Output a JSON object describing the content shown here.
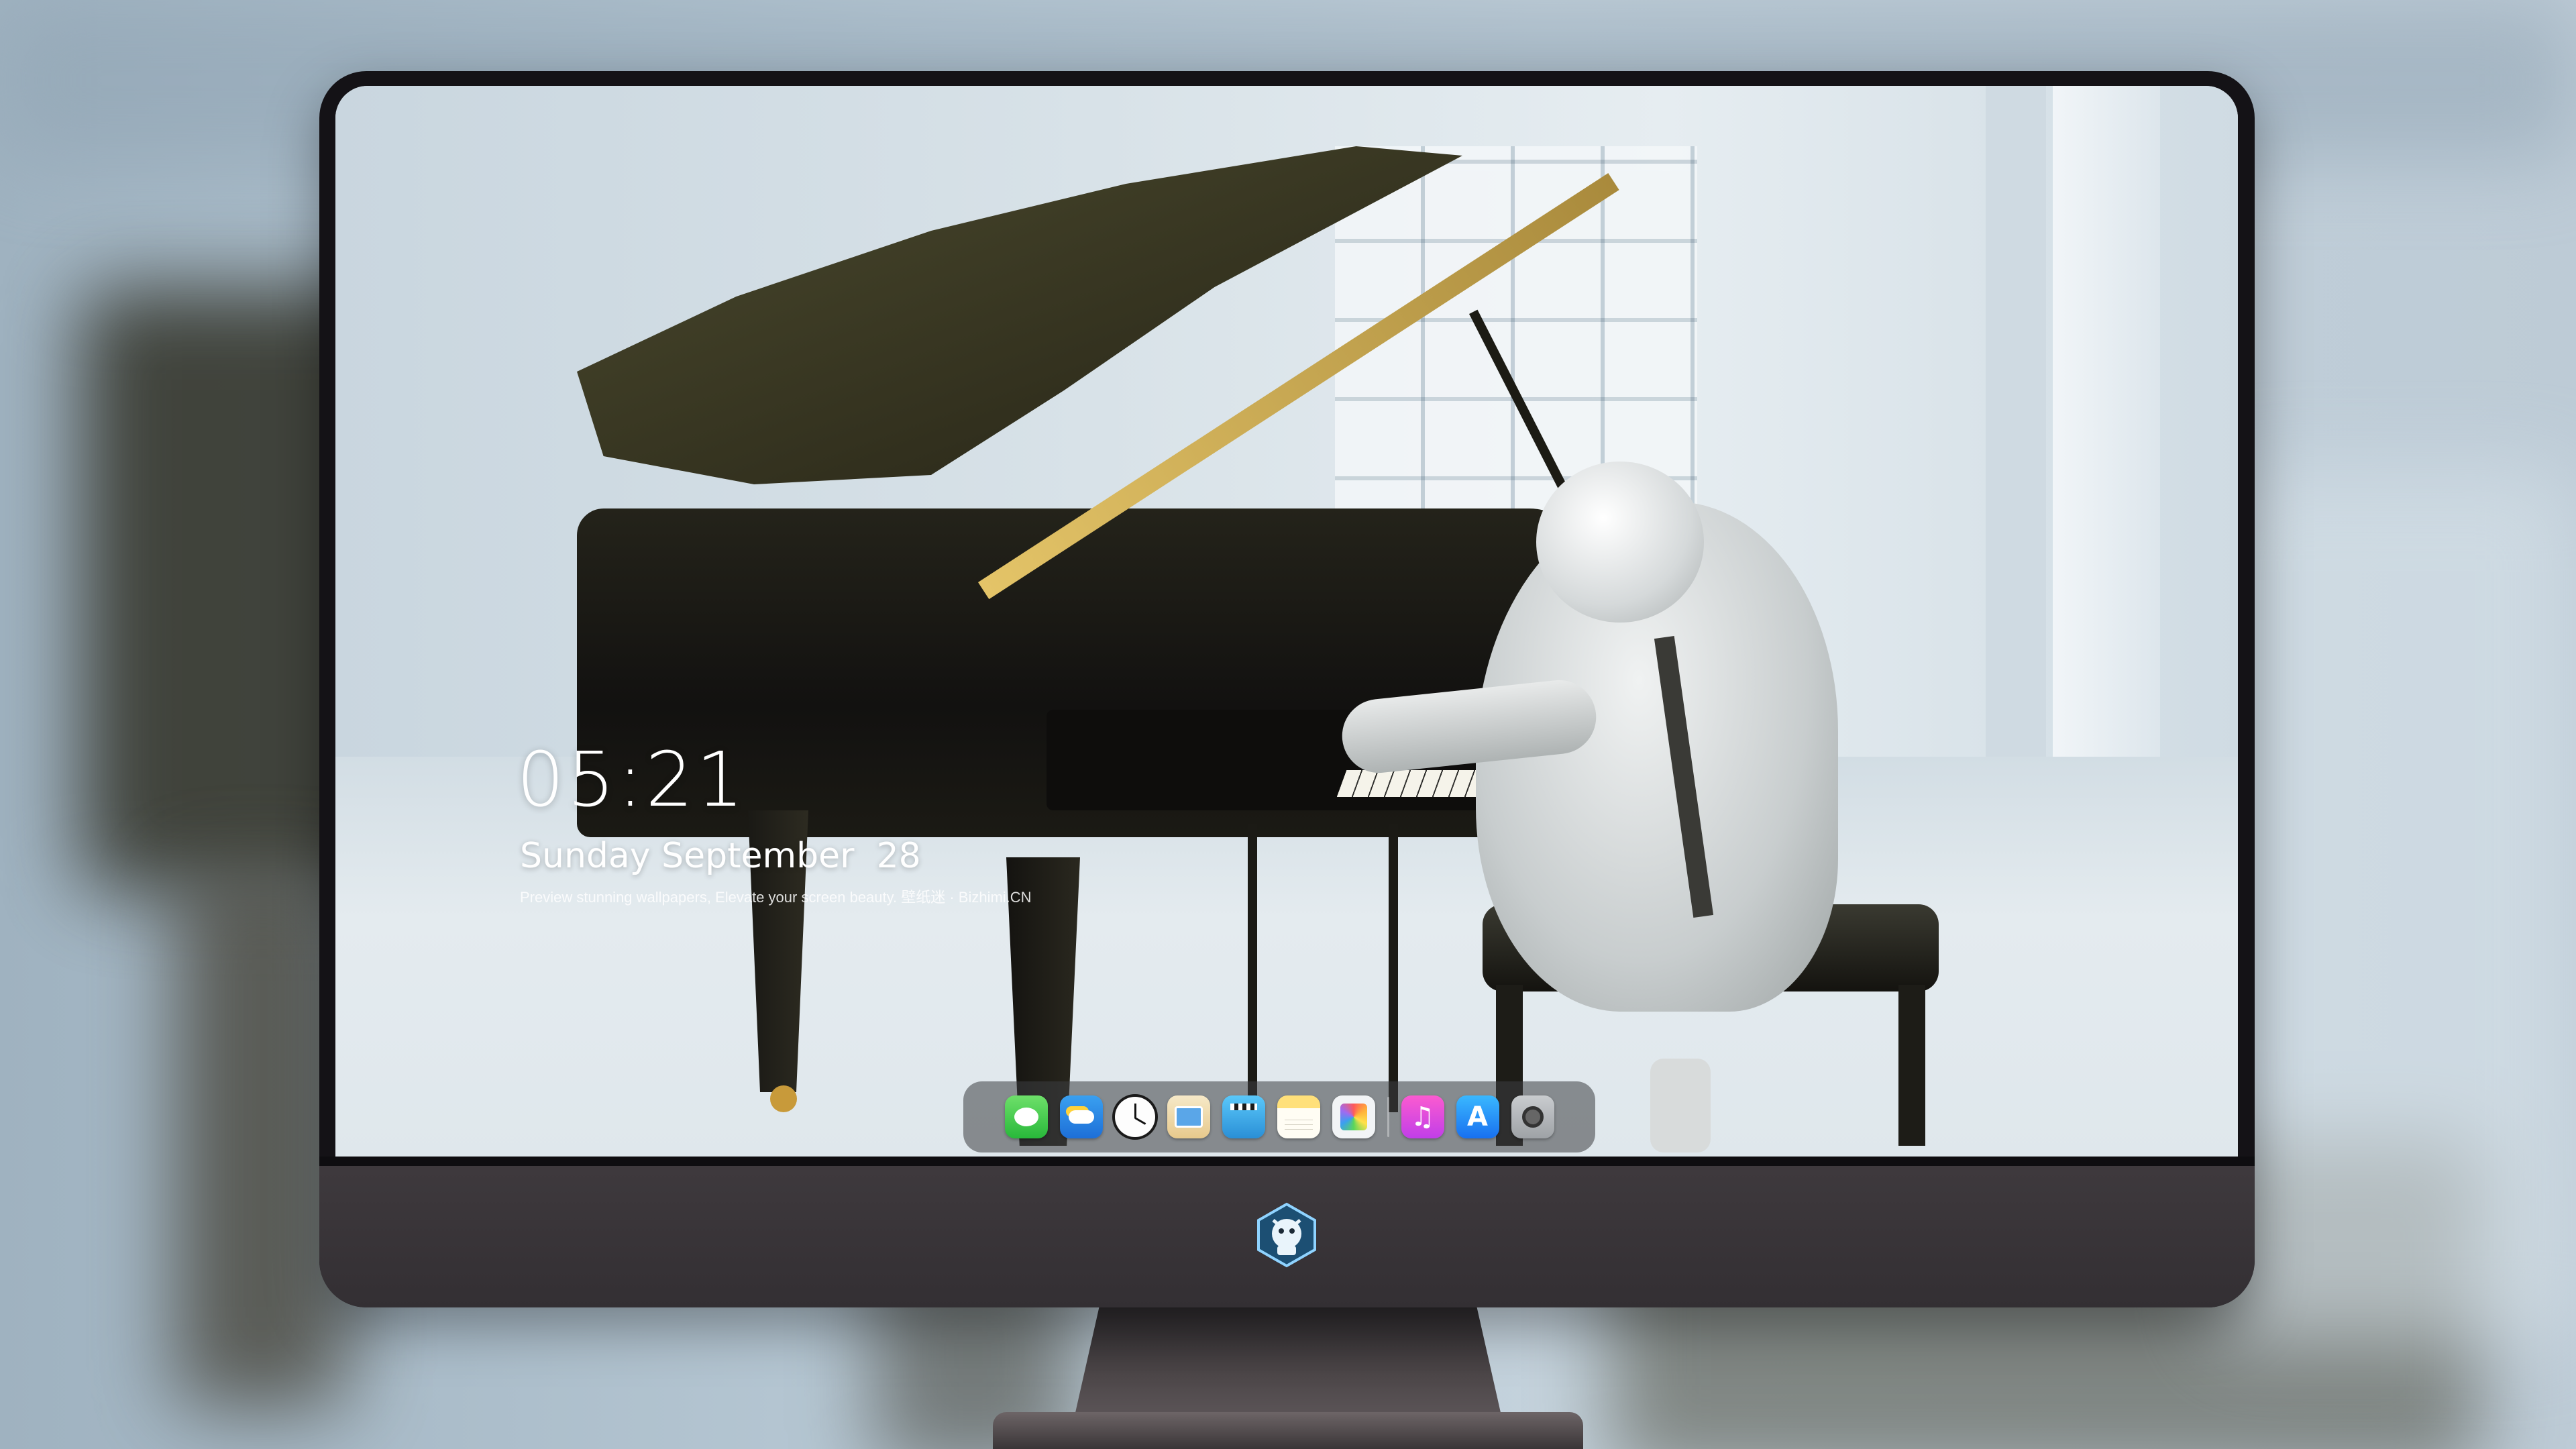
{
  "lockscreen": {
    "time": "05:21",
    "date": "Sunday September  28",
    "caption": "Preview stunning wallpapers, Elevate your screen beauty. 壁纸迷 · Bizhimi.CN"
  },
  "dock": {
    "apps": [
      {
        "name": "messages",
        "icon": "message-bubble-icon",
        "glyph": ""
      },
      {
        "name": "weather",
        "icon": "weather-icon",
        "glyph": ""
      },
      {
        "name": "clock",
        "icon": "clock-icon",
        "glyph": ""
      },
      {
        "name": "preview",
        "icon": "preview-icon",
        "glyph": ""
      },
      {
        "name": "clips",
        "icon": "clapperboard-icon",
        "glyph": ""
      },
      {
        "name": "notes",
        "icon": "notes-icon",
        "glyph": ""
      },
      {
        "name": "photos",
        "icon": "photos-icon",
        "glyph": ""
      },
      {
        "name": "music",
        "icon": "music-note-icon",
        "glyph": "♫"
      },
      {
        "name": "app-store",
        "icon": "app-store-icon",
        "glyph": "A"
      },
      {
        "name": "camera",
        "icon": "camera-icon",
        "glyph": ""
      }
    ]
  },
  "colors": {
    "monitor_bezel": "#141216",
    "monitor_chin": "#3f3a3e",
    "dock_background": "rgba(60,62,66,.55)",
    "text": "#ffffff"
  }
}
